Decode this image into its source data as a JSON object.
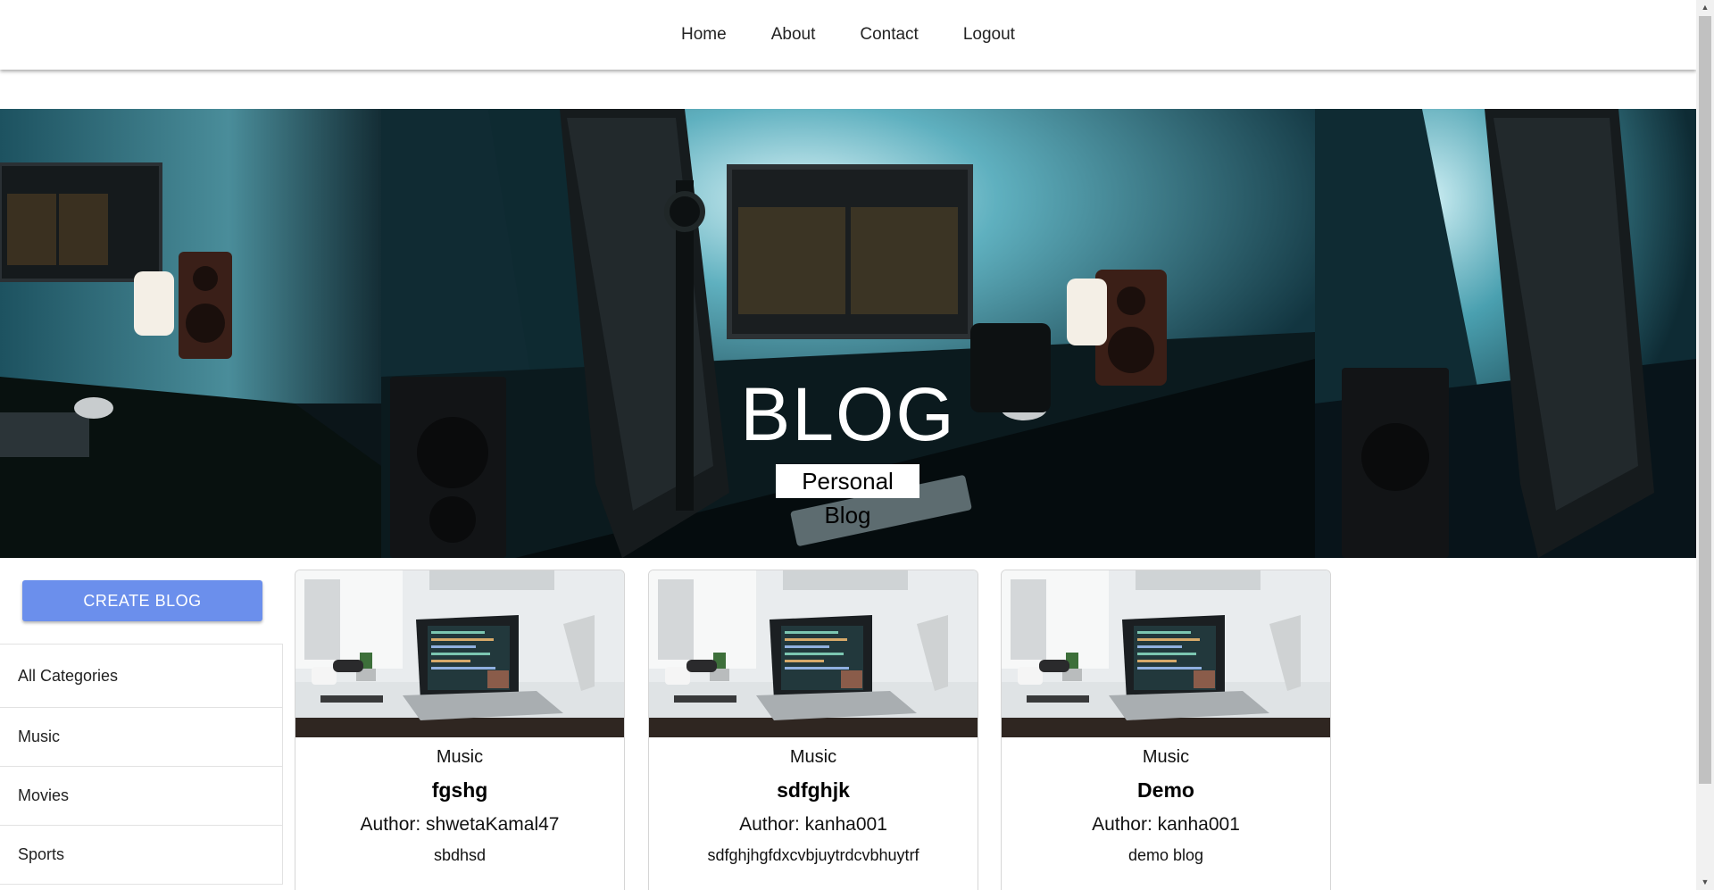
{
  "nav": {
    "items": [
      "Home",
      "About",
      "Contact",
      "Logout"
    ]
  },
  "hero": {
    "title": "BLOG",
    "subtitle": "Personal Blog"
  },
  "sidebar": {
    "create_label": "CREATE BLOG",
    "categories": [
      "All Categories",
      "Music",
      "Movies",
      "Sports"
    ]
  },
  "posts": [
    {
      "category": "Music",
      "title": "fgshg",
      "author": "Author: shwetaKamal47",
      "description": "sbdhsd"
    },
    {
      "category": "Music",
      "title": "sdfghjk",
      "author": "Author: kanha001",
      "description": "sdfghjhgfdxcvbjuytrdcvbhuytrf"
    },
    {
      "category": "Music",
      "title": "Demo",
      "author": "Author: kanha001",
      "description": "demo blog"
    }
  ],
  "colors": {
    "button": "#6b8fec",
    "hero_dark": "#0a1e24"
  }
}
